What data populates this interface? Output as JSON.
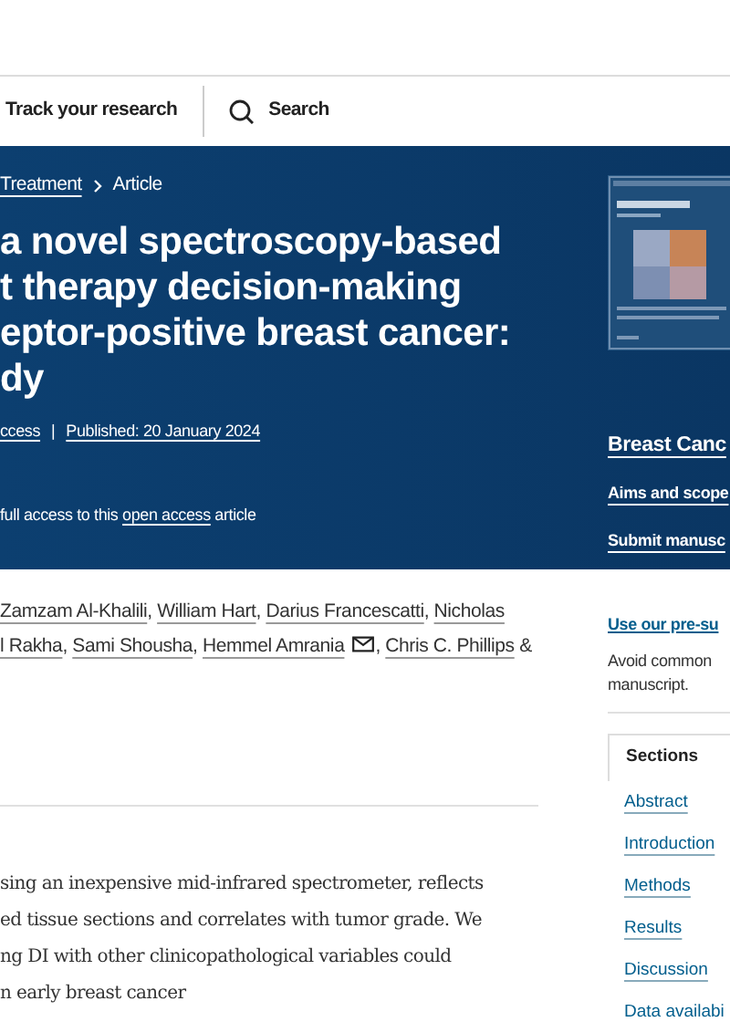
{
  "nav": {
    "items": [
      {
        "label": "Track your research",
        "kind": "text"
      },
      {
        "label": "Search",
        "kind": "search"
      }
    ]
  },
  "breadcrumb": [
    {
      "label": "Treatment",
      "link": true
    },
    {
      "label": "Article",
      "link": false
    }
  ],
  "title_lines": [
    "a novel spectroscopy-based",
    "t therapy decision-making",
    "eptor-positive breast cancer:",
    "dy"
  ],
  "meta": {
    "items": [
      "ccess",
      "Published: 20 January 2024"
    ],
    "separator": "|"
  },
  "access_note": {
    "before": "full access to this",
    "link": "open access",
    "after": "article"
  },
  "journal": {
    "title": "Breast Canc",
    "links": [
      "Aims and scope",
      "Submit manusc"
    ]
  },
  "authors": [
    [
      {
        "name": "Zamzam Al-Khalili",
        "email": false,
        "after": ","
      },
      {
        "name": "William Hart",
        "email": false,
        "after": ","
      },
      {
        "name": "Darius Francescatti",
        "email": false,
        "after": ","
      },
      {
        "name": "Nicholas",
        "email": false
      }
    ],
    [
      {
        "name": "l Rakha",
        "email": false,
        "after": ","
      },
      {
        "name": "Sami Shousha",
        "email": false,
        "after": ","
      },
      {
        "name": "Hemmel Amrania",
        "email": true,
        "after": ","
      },
      {
        "name": "Chris C. Phillips",
        "email": false,
        "after": "&"
      }
    ]
  ],
  "abstract_lines": [
    "sing an inexpensive mid-infrared spectrometer, reflects",
    "ed tissue sections and correlates with tumor grade. We",
    "ng DI with other clinicopathological variables could",
    "n early breast cancer"
  ],
  "promo": {
    "link": "Use our pre-su",
    "text": "Avoid common manuscript."
  },
  "sections": {
    "title": "Sections",
    "items": [
      "Abstract",
      "Introduction",
      "Methods",
      "Results",
      "Discussion",
      "Data availabi"
    ]
  }
}
